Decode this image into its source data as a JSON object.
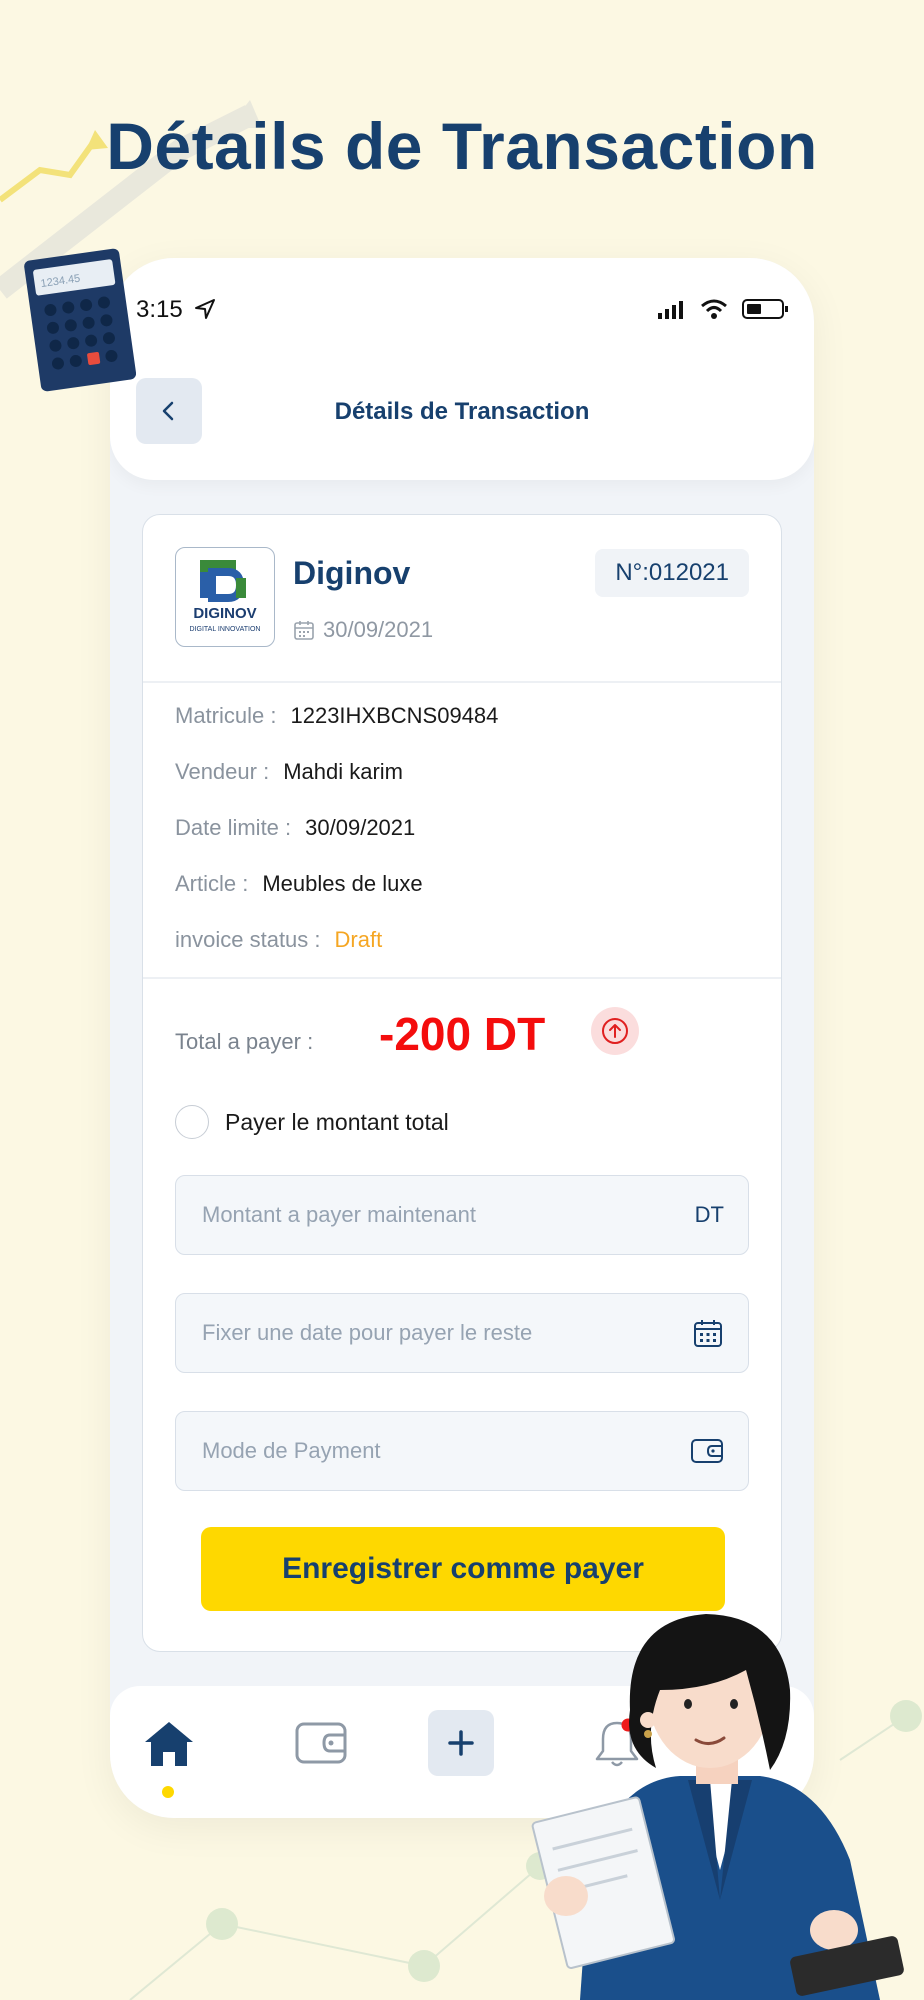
{
  "promo": {
    "title": "Détails de Transaction"
  },
  "status_bar": {
    "time": "3:15"
  },
  "header": {
    "title": "Détails de Transaction",
    "back_icon": "chevron-left-icon"
  },
  "invoice": {
    "company_name": "Diginov",
    "logo_text": "DIGINOV",
    "logo_subtext": "DIGITAL INNOVATION",
    "date": "30/09/2021",
    "number": "N°:012021",
    "details": [
      {
        "label": "Matricule :",
        "value": "1223IHXBCNS09484"
      },
      {
        "label": "Vendeur :",
        "value": "Mahdi karim"
      },
      {
        "label": "Date limite :",
        "value": "30/09/2021"
      },
      {
        "label": "Article :",
        "value": "Meubles de luxe"
      },
      {
        "label": "invoice status :",
        "value": "Draft"
      }
    ],
    "total_label": "Total a payer :",
    "total_value": "-200 DT",
    "status_color": "#f5a623",
    "total_color": "#f40d0d"
  },
  "payment_form": {
    "pay_full_label": "Payer le montant total",
    "amount_placeholder": "Montant a payer maintenant",
    "amount_suffix": "DT",
    "date_placeholder": "Fixer une date pour payer le reste",
    "mode_placeholder": "Mode de Payment",
    "submit_label": "Enregistrer comme payer"
  },
  "bottom_nav": {
    "items": [
      {
        "icon": "home-icon",
        "active": true
      },
      {
        "icon": "wallet-icon",
        "active": false
      },
      {
        "icon": "plus-icon",
        "active": false
      },
      {
        "icon": "bell-icon",
        "active": false,
        "badge": true
      }
    ]
  },
  "colors": {
    "brand": "#17406e",
    "accent": "#fed800",
    "background": "#fcf8e3"
  }
}
